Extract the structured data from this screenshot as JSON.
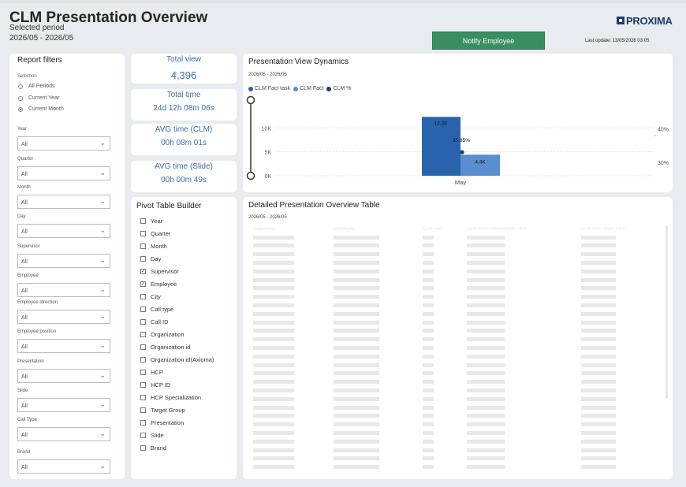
{
  "header": {
    "title": "CLM Presentation Overview",
    "selected_period_label": "Selected period",
    "period": "2026/05 - 2026/05",
    "notify_button": "Notify Employee",
    "logo_text": "PROXIMA",
    "last_update": "Last update: 13/05/2026 03:05"
  },
  "filters": {
    "title": "Report filters",
    "selection_label": "Selection",
    "radios": [
      {
        "label": "All Periods",
        "checked": false
      },
      {
        "label": "Current Year",
        "checked": false
      },
      {
        "label": "Current Month",
        "checked": true
      }
    ],
    "dropdowns": [
      {
        "label": "Year",
        "value": "All"
      },
      {
        "label": "Quarter",
        "value": "All"
      },
      {
        "label": "Month",
        "value": "All"
      },
      {
        "label": "Day",
        "value": "All"
      },
      {
        "label": "Supervisor",
        "value": "All"
      },
      {
        "label": "Employee",
        "value": "All"
      },
      {
        "label": "Employee direction",
        "value": "All"
      },
      {
        "label": "Employee position",
        "value": "All"
      },
      {
        "label": "Presentation",
        "value": "All"
      },
      {
        "label": "Slide",
        "value": "All"
      },
      {
        "label": "Call Type",
        "value": "All"
      },
      {
        "label": "Brand",
        "value": "All"
      }
    ]
  },
  "kpis": {
    "total_view": {
      "label": "Total view",
      "value": "4,396"
    },
    "total_time": {
      "label": "Total time",
      "value": "24d 12h 08m 06s"
    },
    "avg_clm": {
      "label": "AVG time (CLM)",
      "value": "00h 08m 01s"
    },
    "avg_slide": {
      "label": "AVG time (Slide)",
      "value": "00h 00m 49s"
    }
  },
  "pivot": {
    "title": "Pivot Table Builder",
    "items": [
      {
        "label": "Year",
        "checked": false
      },
      {
        "label": "Quarter",
        "checked": false
      },
      {
        "label": "Month",
        "checked": false
      },
      {
        "label": "Day",
        "checked": false
      },
      {
        "label": "Supervisor",
        "checked": true
      },
      {
        "label": "Employee",
        "checked": true
      },
      {
        "label": "City",
        "checked": false
      },
      {
        "label": "Call type",
        "checked": false
      },
      {
        "label": "Call ID",
        "checked": false
      },
      {
        "label": "Organization",
        "checked": false
      },
      {
        "label": "Organization id",
        "checked": false
      },
      {
        "label": "Organization id(Axioma)",
        "checked": false
      },
      {
        "label": "HCP",
        "checked": false
      },
      {
        "label": "HCP ID",
        "checked": false
      },
      {
        "label": "HCP Specialization",
        "checked": false
      },
      {
        "label": "Target Group",
        "checked": false
      },
      {
        "label": "Presentation",
        "checked": false
      },
      {
        "label": "Slide",
        "checked": false
      },
      {
        "label": "Brand",
        "checked": false
      }
    ]
  },
  "chart_panel": {
    "title": "Presentation View Dynamics",
    "period": "2026/05 - 2026/05",
    "colors": {
      "fact_task": "#2a63ad",
      "fact": "#5a8ed0",
      "pct": "#1f3a6b"
    }
  },
  "chart_data": {
    "type": "bar",
    "categories": [
      "May"
    ],
    "series": [
      {
        "name": "CLM Fact task",
        "values": [
          12300
        ],
        "label": "12.3K"
      },
      {
        "name": "CLM Fact",
        "values": [
          4400
        ],
        "label": "4.4K"
      },
      {
        "name": "CLM %",
        "values": [
          35.85
        ],
        "label": "35.85%"
      }
    ],
    "y_ticks": [
      "0K",
      "5K",
      "10K"
    ],
    "y2_ticks": [
      "30%",
      "40%"
    ],
    "ylim": [
      0,
      14000
    ],
    "y2lim": [
      26,
      46
    ]
  },
  "table_panel": {
    "title": "Detailed Presentation Overview Table",
    "period": "2026/05 - 2026/05",
    "columns": [
      "Supervisor",
      "Employee",
      "CLM Fact",
      "CLM AVG Presentation Time",
      "CLM AVG Slide Time"
    ]
  }
}
